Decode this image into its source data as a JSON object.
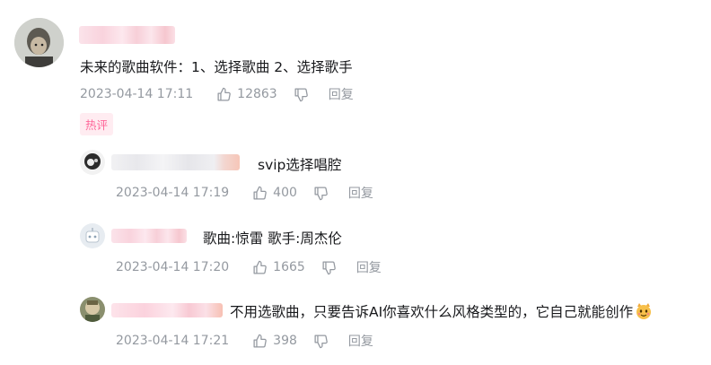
{
  "comment": {
    "content": "未来的歌曲软件：1、选择歌曲 2、选择歌手",
    "time": "2023-04-14 17:11",
    "likes": "12863",
    "reply_label": "回复",
    "tag": "热评"
  },
  "replies": [
    {
      "content": "svip选择唱腔",
      "time": "2023-04-14 17:19",
      "likes": "400",
      "reply_label": "回复"
    },
    {
      "content": "歌曲:惊雷 歌手:周杰伦",
      "time": "2023-04-14 17:20",
      "likes": "1665",
      "reply_label": "回复"
    },
    {
      "content": "不用选歌曲，只要告诉AI你喜欢什么风格类型的，它自己就能创作",
      "time": "2023-04-14 17:21",
      "likes": "398",
      "reply_label": "回复"
    }
  ],
  "icons": [
    "thumb-up-icon",
    "thumb-down-icon",
    "cat-emoji-icon"
  ],
  "colors": {
    "meta_text": "#9499a0",
    "hot_tag": "#ff6699",
    "hot_tag_bg": "#ffecf1"
  }
}
